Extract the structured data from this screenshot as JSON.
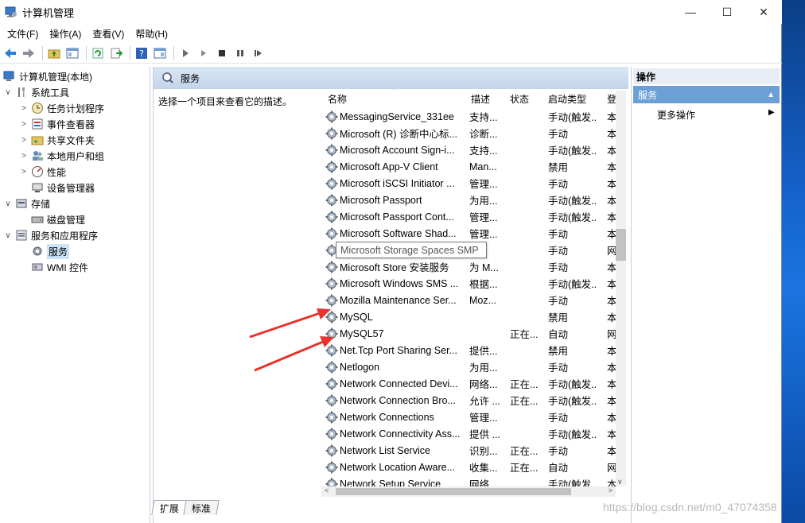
{
  "window": {
    "title": "计算机管理",
    "minimize": "—",
    "maximize": "☐",
    "close": "✕"
  },
  "menu": [
    "文件(F)",
    "操作(A)",
    "查看(V)",
    "帮助(H)"
  ],
  "toolbar": [
    "back-icon",
    "forward-icon",
    "up-folder-icon",
    "console-tree-icon",
    "refresh-icon",
    "export-list-icon",
    "help-icon",
    "view-icon",
    "start-icon",
    "start-alt-icon",
    "stop-icon",
    "pause-icon",
    "restart-icon"
  ],
  "tree": {
    "root": "计算机管理(本地)",
    "items": [
      {
        "label": "系统工具",
        "level": 1,
        "expand": "∨",
        "icon": "tools-icon"
      },
      {
        "label": "任务计划程序",
        "level": 2,
        "expand": ">",
        "icon": "clock-icon"
      },
      {
        "label": "事件查看器",
        "level": 2,
        "expand": ">",
        "icon": "event-viewer-icon"
      },
      {
        "label": "共享文件夹",
        "level": 2,
        "expand": ">",
        "icon": "shared-folder-icon"
      },
      {
        "label": "本地用户和组",
        "level": 2,
        "expand": ">",
        "icon": "users-icon"
      },
      {
        "label": "性能",
        "level": 2,
        "expand": ">",
        "icon": "performance-icon"
      },
      {
        "label": "设备管理器",
        "level": 2,
        "expand": "",
        "icon": "device-manager-icon"
      },
      {
        "label": "存储",
        "level": 1,
        "expand": "∨",
        "icon": "storage-icon"
      },
      {
        "label": "磁盘管理",
        "level": 2,
        "expand": "",
        "icon": "disk-icon"
      },
      {
        "label": "服务和应用程序",
        "level": 1,
        "expand": "∨",
        "icon": "services-apps-icon"
      },
      {
        "label": "服务",
        "level": 2,
        "expand": "",
        "icon": "gear-icon",
        "selected": true
      },
      {
        "label": "WMI 控件",
        "level": 2,
        "expand": "",
        "icon": "wmi-icon"
      }
    ]
  },
  "center": {
    "header": "服务",
    "description": "选择一个项目来查看它的描述。",
    "columns": {
      "name": "名称",
      "desc": "描述",
      "state": "状态",
      "startup": "启动类型",
      "logon": "登"
    },
    "rows": [
      {
        "name": "MessagingService_331ee",
        "desc": "支持...",
        "state": "",
        "startup": "手动(触发...",
        "logon": "本"
      },
      {
        "name": "Microsoft (R) 诊断中心标...",
        "desc": "诊断...",
        "state": "",
        "startup": "手动",
        "logon": "本"
      },
      {
        "name": "Microsoft Account Sign-i...",
        "desc": "支持...",
        "state": "",
        "startup": "手动(触发...",
        "logon": "本"
      },
      {
        "name": "Microsoft App-V Client",
        "desc": "Man...",
        "state": "",
        "startup": "禁用",
        "logon": "本"
      },
      {
        "name": "Microsoft iSCSI Initiator ...",
        "desc": "管理...",
        "state": "",
        "startup": "手动",
        "logon": "本"
      },
      {
        "name": "Microsoft Passport",
        "desc": "为用...",
        "state": "",
        "startup": "手动(触发...",
        "logon": "本"
      },
      {
        "name": "Microsoft Passport Cont...",
        "desc": "管理...",
        "state": "",
        "startup": "手动(触发...",
        "logon": "本"
      },
      {
        "name": "Microsoft Software Shad...",
        "desc": "管理...",
        "state": "",
        "startup": "手动",
        "logon": "本"
      },
      {
        "name": "Microsoft Storage Spaces SMP",
        "desc": "...",
        "state": "",
        "startup": "手动",
        "logon": "网"
      },
      {
        "name": "Microsoft Store 安装服务",
        "desc": "为 M...",
        "state": "",
        "startup": "手动",
        "logon": "本"
      },
      {
        "name": "Microsoft Windows SMS ...",
        "desc": "根据...",
        "state": "",
        "startup": "手动(触发...",
        "logon": "本"
      },
      {
        "name": "Mozilla Maintenance Ser...",
        "desc": "Moz...",
        "state": "",
        "startup": "手动",
        "logon": "本"
      },
      {
        "name": "MySQL",
        "desc": "",
        "state": "",
        "startup": "禁用",
        "logon": "本"
      },
      {
        "name": "MySQL57",
        "desc": "",
        "state": "正在...",
        "startup": "自动",
        "logon": "网"
      },
      {
        "name": "Net.Tcp Port Sharing Ser...",
        "desc": "提供...",
        "state": "",
        "startup": "禁用",
        "logon": "本"
      },
      {
        "name": "Netlogon",
        "desc": "为用...",
        "state": "",
        "startup": "手动",
        "logon": "本"
      },
      {
        "name": "Network Connected Devi...",
        "desc": "网络...",
        "state": "正在...",
        "startup": "手动(触发...",
        "logon": "本"
      },
      {
        "name": "Network Connection Bro...",
        "desc": "允许 ...",
        "state": "正在...",
        "startup": "手动(触发...",
        "logon": "本"
      },
      {
        "name": "Network Connections",
        "desc": "管理...",
        "state": "",
        "startup": "手动",
        "logon": "本"
      },
      {
        "name": "Network Connectivity Ass...",
        "desc": "提供 ...",
        "state": "",
        "startup": "手动(触发...",
        "logon": "本"
      },
      {
        "name": "Network List Service",
        "desc": "识别...",
        "state": "正在...",
        "startup": "手动",
        "logon": "本"
      },
      {
        "name": "Network Location Aware...",
        "desc": "收集...",
        "state": "正在...",
        "startup": "自动",
        "logon": "网"
      },
      {
        "name": "Network Setup Service",
        "desc": "网络...",
        "state": "",
        "startup": "手动(触发...",
        "logon": "本"
      }
    ],
    "tooltip": "Microsoft Storage Spaces SMP",
    "tabs": [
      "扩展",
      "标准"
    ]
  },
  "actions": {
    "header": "操作",
    "section": "服务",
    "section_toggle": "▲",
    "item": "更多操作",
    "item_arrow": "▶"
  },
  "watermark": "https://blog.csdn.net/m0_47074358"
}
